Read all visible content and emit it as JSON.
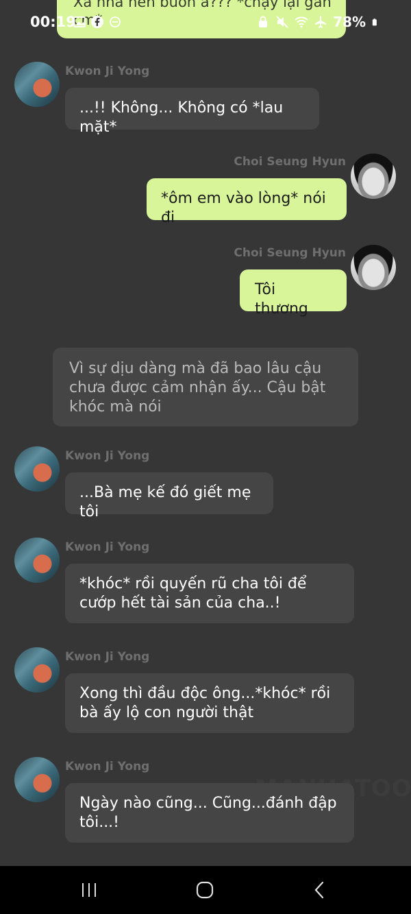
{
  "status_bar": {
    "time": "00:19",
    "battery": "78%",
    "icons_left": [
      "gallery-icon",
      "facebook-icon",
      "dnd-icon"
    ],
    "icons_right": [
      "vpn-icon",
      "mute-icon",
      "wifi-icon",
      "airplane-icon",
      "battery-icon"
    ]
  },
  "top_bubble": {
    "text": "Xa nhà nên buồn à??? *chạy lại gần cm*"
  },
  "messages": [
    {
      "side": "left",
      "sender": "Kwon Ji Yong",
      "text": "...!! Không... Không có *lau mặt*"
    },
    {
      "side": "right",
      "sender": "Choi Seung Hyun",
      "text": "*ôm em vào lòng* nói đi"
    },
    {
      "side": "right",
      "sender": "Choi Seung Hyun",
      "text": "Tôi thương"
    },
    {
      "side": "center",
      "sender": "",
      "text": "Vì sự dịu dàng mà đã bao lâu cậu chưa được cảm nhận ấy... Cậu bật khóc mà nói"
    },
    {
      "side": "left",
      "sender": "Kwon Ji Yong",
      "text": "...Bà mẹ kế đó giết mẹ tôi"
    },
    {
      "side": "left",
      "sender": "Kwon Ji Yong",
      "text": "*khóc* rồi quyến rũ cha tôi để cướp hết tài sản của cha..!"
    },
    {
      "side": "left",
      "sender": "Kwon Ji Yong",
      "text": "Xong thì đầu độc ông...*khóc* rồi bà ấy lộ con người thật"
    },
    {
      "side": "left",
      "sender": "Kwon Ji Yong",
      "text": "Ngày nào cũng... Cũng...đánh đập tôi...!"
    }
  ],
  "watermark": "MANHATOON",
  "nav_bar": {
    "buttons": [
      "recent-apps",
      "home",
      "back"
    ]
  },
  "colors": {
    "background": "#363636",
    "bubble_dark": "#454545",
    "bubble_green": "#d8f59a",
    "sender_name": "#6f6f6f"
  }
}
